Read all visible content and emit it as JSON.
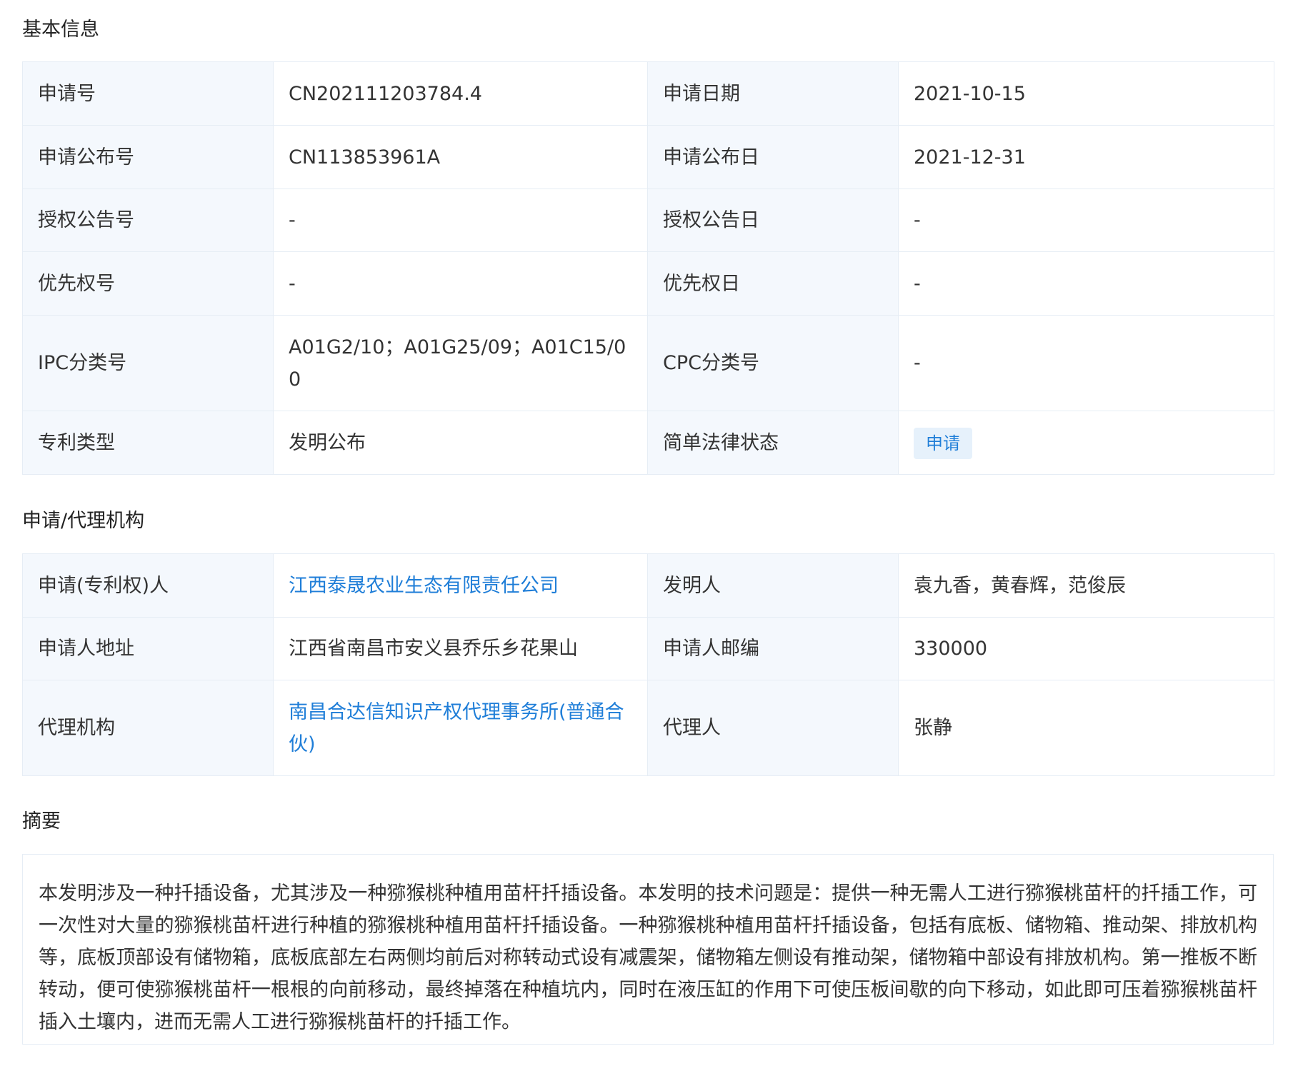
{
  "basic": {
    "title": "基本信息",
    "rows": [
      {
        "l1": "申请号",
        "v1": "CN202111203784.4",
        "l2": "申请日期",
        "v2": "2021-10-15"
      },
      {
        "l1": "申请公布号",
        "v1": "CN113853961A",
        "l2": "申请公布日",
        "v2": "2021-12-31"
      },
      {
        "l1": "授权公告号",
        "v1": "-",
        "l2": "授权公告日",
        "v2": "-"
      },
      {
        "l1": "优先权号",
        "v1": "-",
        "l2": "优先权日",
        "v2": "-"
      },
      {
        "l1": "IPC分类号",
        "v1": "A01G2/10；A01G25/09；A01C15/00",
        "l2": "CPC分类号",
        "v2": "-"
      },
      {
        "l1": "专利类型",
        "v1": "发明公布",
        "l2": "简单法律状态",
        "v2": "申请"
      }
    ]
  },
  "agency": {
    "title": "申请/代理机构",
    "rows": [
      {
        "l1": "申请(专利权)人",
        "v1": "江西泰晟农业生态有限责任公司",
        "l2": "发明人",
        "v2": "袁九香，黄春辉，范俊辰"
      },
      {
        "l1": "申请人地址",
        "v1": "江西省南昌市安义县乔乐乡花果山",
        "l2": "申请人邮编",
        "v2": "330000"
      },
      {
        "l1": "代理机构",
        "v1": "南昌合达信知识产权代理事务所(普通合伙)",
        "l2": "代理人",
        "v2": "张静"
      }
    ]
  },
  "abstract": {
    "title": "摘要",
    "text": "本发明涉及一种扦插设备，尤其涉及一种猕猴桃种植用苗杆扦插设备。本发明的技术问题是：提供一种无需人工进行猕猴桃苗杆的扦插工作，可一次性对大量的猕猴桃苗杆进行种植的猕猴桃种植用苗杆扦插设备。一种猕猴桃种植用苗杆扦插设备，包括有底板、储物箱、推动架、排放机构等，底板顶部设有储物箱，底板底部左右两侧均前后对称转动式设有减震架，储物箱左侧设有推动架，储物箱中部设有排放机构。第一推板不断转动，便可使猕猴桃苗杆一根根的向前移动，最终掉落在种植坑内，同时在液压缸的作用下可使压板间歇的向下移动，如此即可压着猕猴桃苗杆插入土壤内，进而无需人工进行猕猴桃苗杆的扦插工作。"
  }
}
